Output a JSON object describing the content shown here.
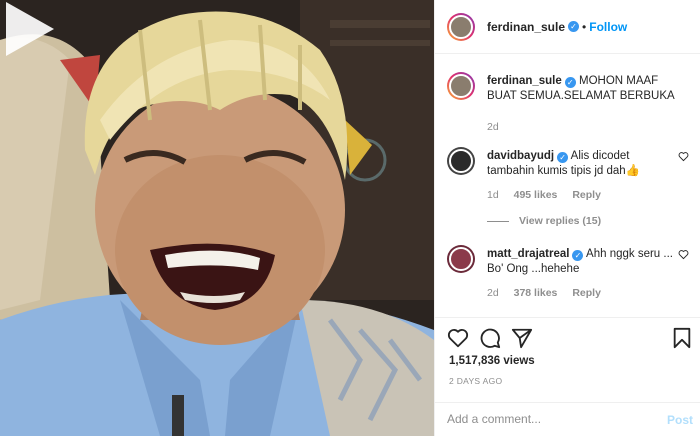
{
  "post": {
    "author": "ferdinan_sule",
    "follow_label": "Follow",
    "dot": "•",
    "caption": "MOHON MAAF BUAT SEMUA.SELAMAT BERBUKA",
    "caption_age": "2d"
  },
  "comments": [
    {
      "user": "davidbayudj",
      "text": "Alis dicodet tambahin kumis tipis jd dah👍",
      "age": "1d",
      "likes": "495 likes",
      "reply_label": "Reply",
      "view_replies": "View replies (15)"
    },
    {
      "user": "matt_drajatreal",
      "text": "Ahh nggk seru ... Bo' Ong ...hehehe",
      "age": "2d",
      "likes": "378 likes",
      "reply_label": "Reply"
    }
  ],
  "stats": {
    "views": "1,517,836 views",
    "posted": "2 DAYS AGO"
  },
  "composer": {
    "placeholder": "Add a comment...",
    "post_label": "Post"
  },
  "icons": [
    "play-icon",
    "verified-icon",
    "heart-icon",
    "comment-icon",
    "share-icon",
    "bookmark-icon"
  ],
  "colors": {
    "link_blue": "#0095f6",
    "verified_blue": "#3897f0",
    "muted_gray": "#8e8e8e",
    "post_disabled": "#b2dffc"
  }
}
